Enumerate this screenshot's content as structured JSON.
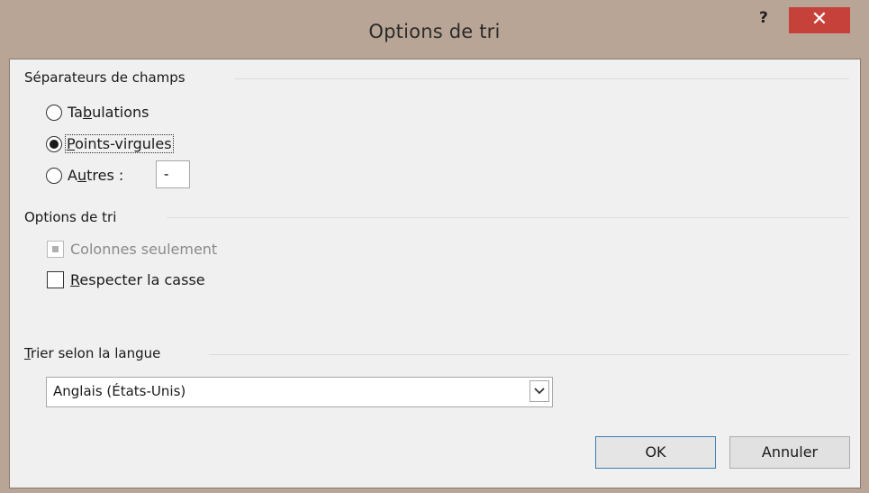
{
  "window": {
    "title": "Options de tri",
    "help_label": "?",
    "close_label": "✕"
  },
  "separators": {
    "heading": "Séparateurs de champs",
    "tabs": {
      "before": "Ta",
      "accel": "b",
      "after": "ulations",
      "selected": false
    },
    "semicolons": {
      "before": "",
      "accel": "P",
      "after": "oints-virgules",
      "selected": true
    },
    "other": {
      "before": "A",
      "accel": "u",
      "after": "tres :",
      "selected": false,
      "value": "-"
    }
  },
  "sort_options": {
    "heading": "Options de tri",
    "columns_only": {
      "label": "Colonnes seulement",
      "checked": false,
      "enabled": false
    },
    "case": {
      "before": "",
      "accel": "R",
      "after": "especter la casse",
      "checked": false
    }
  },
  "language": {
    "heading": {
      "before": "",
      "accel": "T",
      "after": "rier selon la langue"
    },
    "selected": "Anglais (États-Unis)",
    "dropdown_icon": "chevron-down-icon"
  },
  "buttons": {
    "ok": "OK",
    "cancel": "Annuler"
  },
  "colors": {
    "title_bar": "#b8a595",
    "close": "#c7413b",
    "accent_border": "#3c7fb1"
  }
}
